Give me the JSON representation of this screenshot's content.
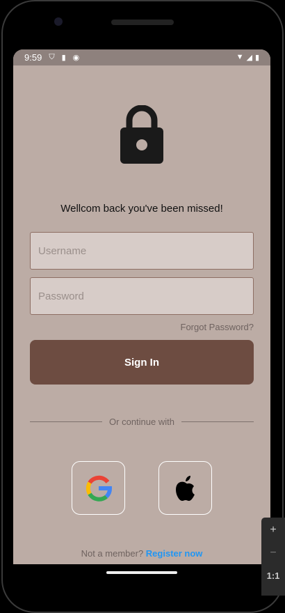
{
  "status_bar": {
    "time": "9:59"
  },
  "header": {
    "welcome": "Wellcom back you've been missed!"
  },
  "form": {
    "username_placeholder": "Username",
    "password_placeholder": "Password",
    "forgot": "Forgot Password?",
    "sign_in": "Sign In"
  },
  "divider": {
    "label": "Or continue with"
  },
  "social": [
    {
      "icon": "google-icon"
    },
    {
      "icon": "apple-icon"
    }
  ],
  "footer": {
    "prompt": "Not a member?",
    "register": "Register now"
  },
  "emulator": {
    "zoom_in": "+",
    "zoom_out": "−",
    "actual": "1:1"
  },
  "colors": {
    "background": "#bcaca5",
    "button": "#6d4c41",
    "link": "#2196f3"
  }
}
